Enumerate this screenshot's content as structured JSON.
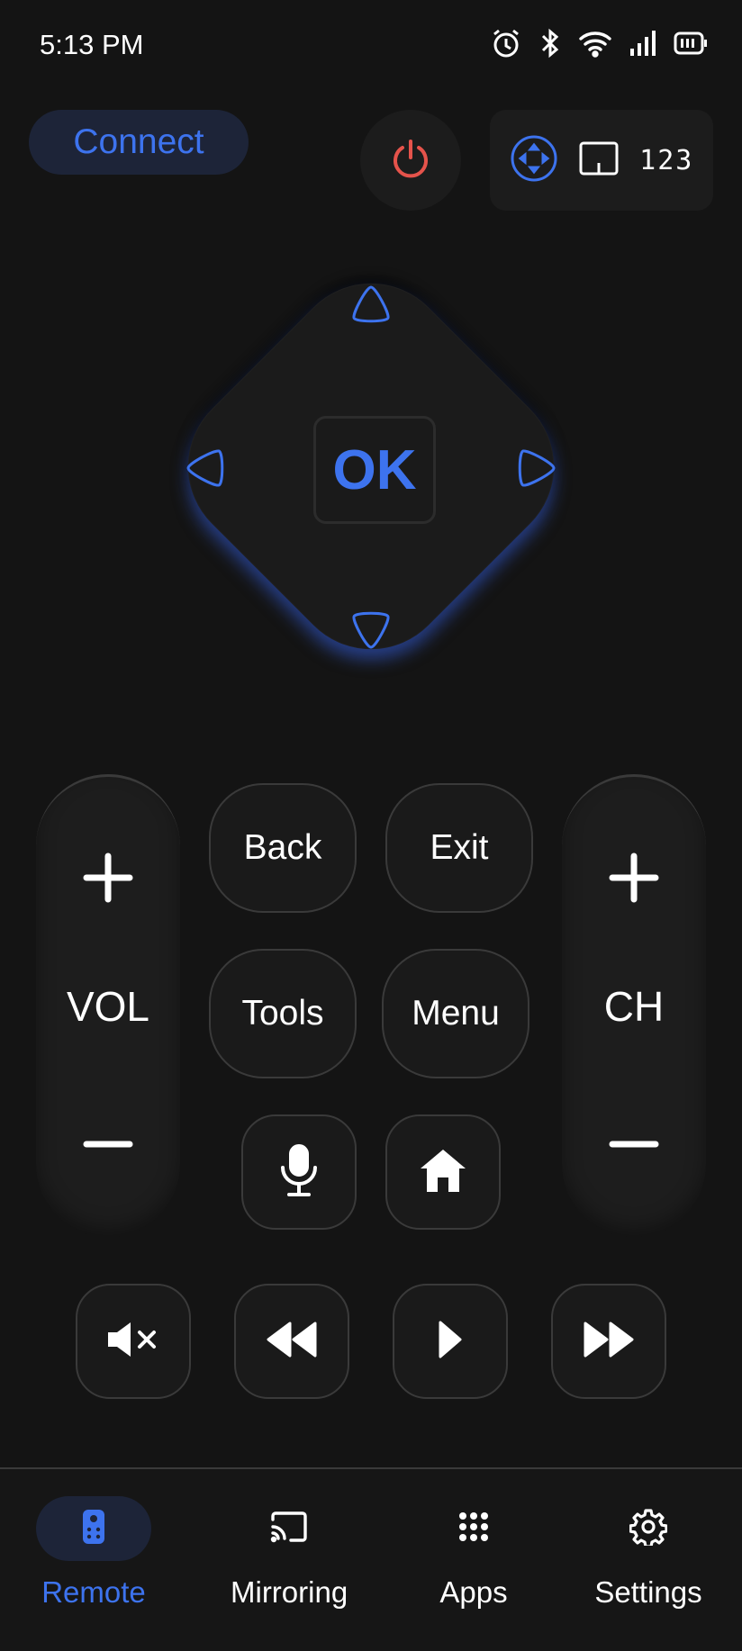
{
  "status_bar": {
    "time": "5:13 PM",
    "icons": [
      "alarm-icon",
      "bluetooth-icon",
      "wifi-icon",
      "signal-icon",
      "battery-icon"
    ]
  },
  "top": {
    "connect_label": "Connect",
    "power_icon": "power-icon",
    "mode_icons": [
      "dpad-mode-icon",
      "touchpad-mode-icon"
    ],
    "numpad_label": "123"
  },
  "dpad": {
    "ok_label": "OK"
  },
  "volume": {
    "label": "VOL"
  },
  "channel": {
    "label": "CH"
  },
  "buttons": {
    "back": "Back",
    "exit": "Exit",
    "tools": "Tools",
    "menu": "Menu"
  },
  "nav": {
    "items": [
      {
        "label": "Remote",
        "icon": "remote-icon",
        "active": true
      },
      {
        "label": "Mirroring",
        "icon": "cast-icon",
        "active": false
      },
      {
        "label": "Apps",
        "icon": "apps-grid-icon",
        "active": false
      },
      {
        "label": "Settings",
        "icon": "gear-icon",
        "active": false
      }
    ]
  },
  "colors": {
    "accent": "#3d73ee",
    "power": "#e5534b",
    "background": "#141414"
  }
}
